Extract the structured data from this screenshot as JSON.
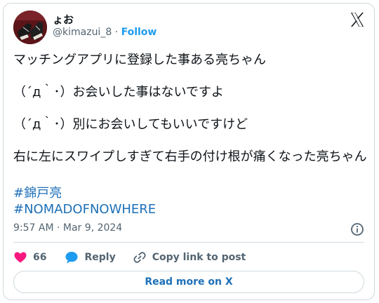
{
  "header": {
    "display_name": "ょお",
    "handle": "@kimazui_8",
    "separator": "·",
    "follow_label": "Follow"
  },
  "tweet": {
    "text": "マッチングアプリに登録した事ある亮ちゃん\n\n（´д｀･）お会いした事はないですよ\n\n（´д｀･）別にお会いしてもいいですけど\n\n右に左にスワイプしすぎて右手の付け根が痛くなった亮ちゃん",
    "hashtags": [
      "#錦戸亮",
      "#NOMADOFNOWHERE"
    ],
    "timestamp": "9:57 AM · Mar 9, 2024"
  },
  "actions": {
    "like_count": "66",
    "reply_label": "Reply",
    "copy_label": "Copy link to post"
  },
  "footer": {
    "read_more_label": "Read more on X"
  },
  "colors": {
    "accent": "#1d9bf0",
    "link": "#1d70b8",
    "like": "#f91880",
    "muted": "#536471"
  },
  "icons": [
    "x-logo-icon",
    "info-icon",
    "heart-icon",
    "reply-bubble-icon",
    "link-icon"
  ]
}
